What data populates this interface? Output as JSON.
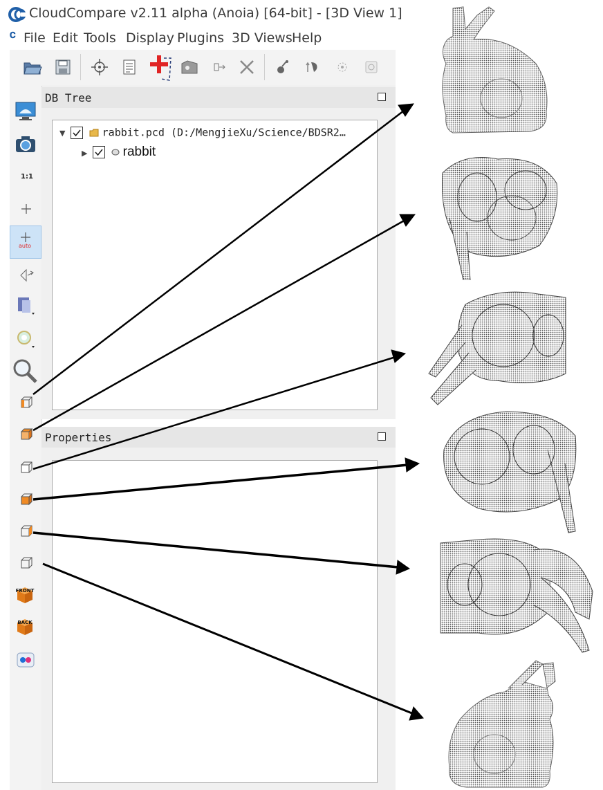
{
  "window": {
    "title": "CloudCompare v2.11 alpha (Anoia) [64-bit] - [3D View 1]",
    "logo_glyph": "C"
  },
  "menubar": {
    "logo_glyph": "C",
    "items": [
      "File",
      "Edit",
      "Tools",
      "Display",
      "Plugins",
      "3D Views",
      "Help"
    ]
  },
  "toolbar": {
    "icons": [
      "open-folder-icon",
      "save-icon",
      "point-picking-icon",
      "list-icon",
      "add-point-icon",
      "segment-icon",
      "translate-icon",
      "delete-icon",
      "merge-icon",
      "tree-icon",
      "sample-icon",
      "settings-icon"
    ]
  },
  "left_toolbar": {
    "ratio_label": "1:1",
    "auto_label": "auto",
    "front_label": "FRONT",
    "back_label": "BACK"
  },
  "db_tree": {
    "title": "DB Tree",
    "root_item": "rabbit.pcd (D:/MengjieXu/Science/BDSR2…",
    "child_item": "rabbit"
  },
  "properties": {
    "title": "Properties"
  },
  "views": [
    "left-view",
    "top-view",
    "front-view",
    "bottom-view",
    "back-view",
    "right-view"
  ],
  "colors": {
    "accent": "#1f5fa8",
    "orange_cube": "#f08a24",
    "highlight": "#cde3f7"
  }
}
